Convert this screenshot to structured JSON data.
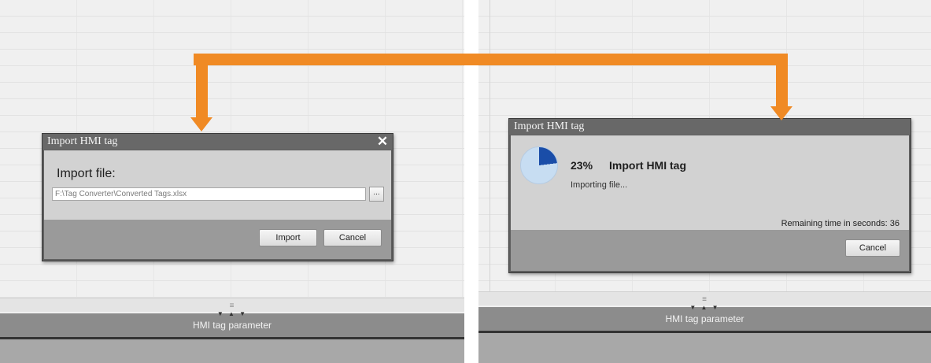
{
  "import_dialog": {
    "title": "Import HMI tag",
    "close_label": "✕",
    "import_file_label": "Import file:",
    "file_path": "F:\\Tag Converter\\Converted Tags.xlsx",
    "browse_label": "...",
    "import_button": "Import",
    "cancel_button": "Cancel"
  },
  "progress_dialog": {
    "title": "Import HMI tag",
    "percent": "23%",
    "progress_fraction": 0.23,
    "operation": "Import HMI tag",
    "status": "Importing file...",
    "remaining_time": "Remaining time in seconds: 36",
    "cancel_button": "Cancel"
  },
  "workspace": {
    "left_panel_label": "HMI tag parameter",
    "right_panel_label": "HMI tag parameter",
    "splitter_handle": "≡"
  },
  "colors": {
    "arrow": "#f08a24",
    "progress_fill": "#1a4da8",
    "progress_remaining": "#c7ddf2",
    "dialog_frame": "#5f5f5f"
  }
}
